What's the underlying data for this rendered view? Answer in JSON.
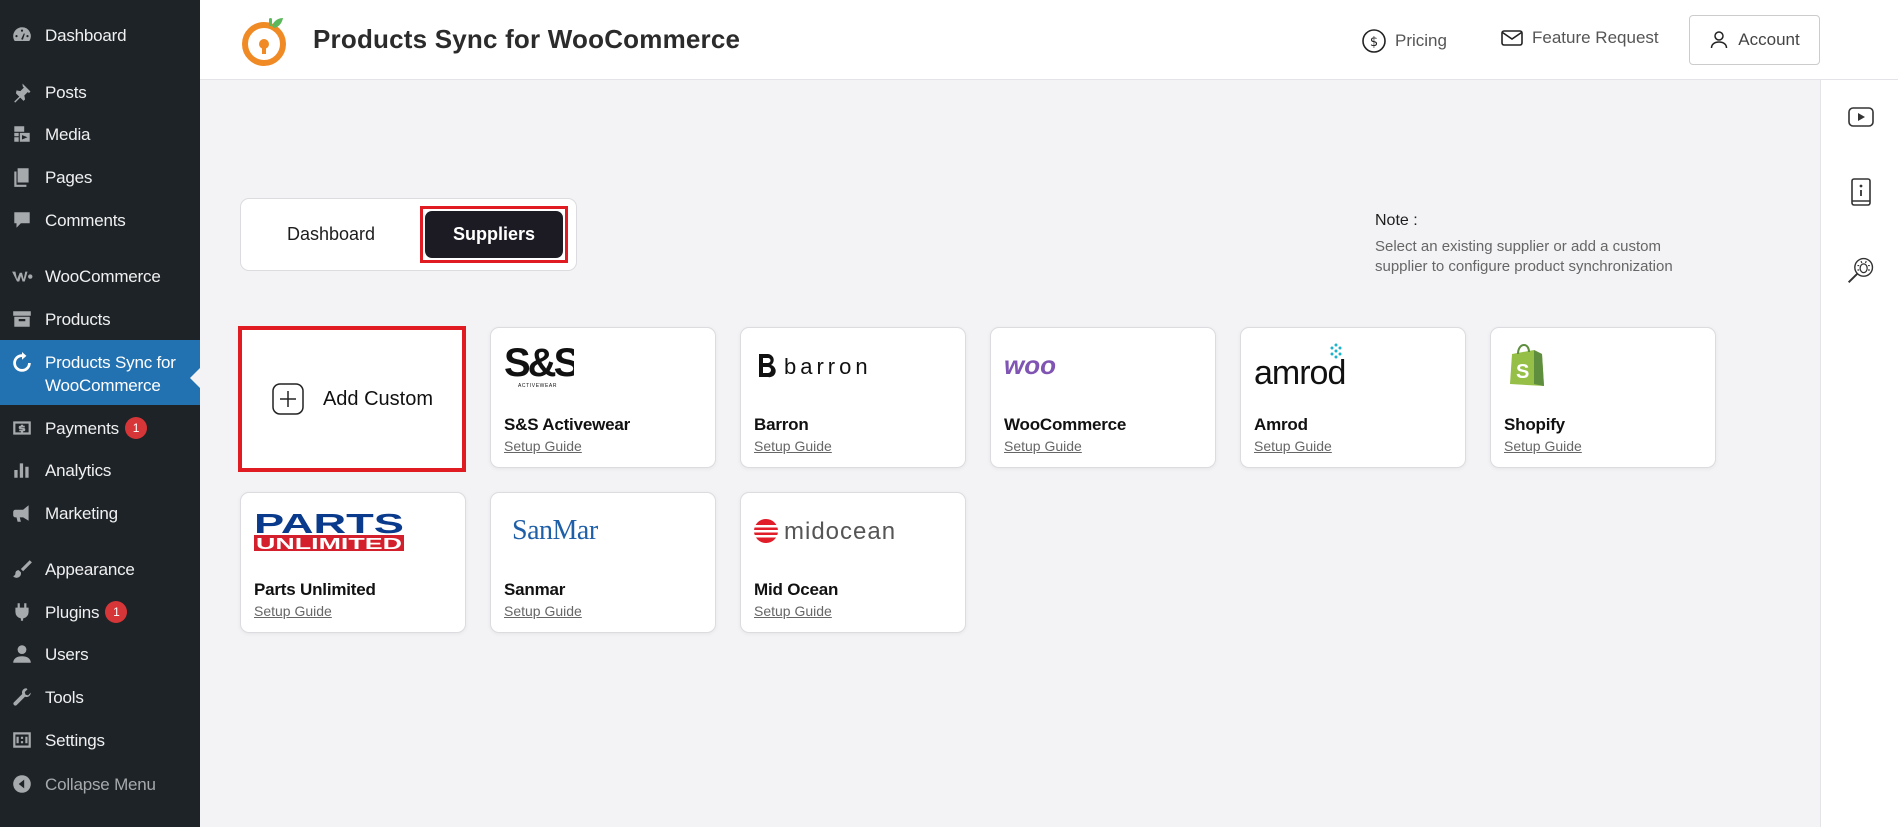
{
  "sidebar": {
    "items": [
      {
        "label": "Dashboard",
        "icon": "dashboard-icon"
      },
      {
        "label": "Posts",
        "icon": "pushpin-icon"
      },
      {
        "label": "Media",
        "icon": "media-icon"
      },
      {
        "label": "Pages",
        "icon": "pages-icon"
      },
      {
        "label": "Comments",
        "icon": "comment-icon"
      },
      {
        "label": "WooCommerce",
        "icon": "woocommerce-icon"
      },
      {
        "label": "Products",
        "icon": "archive-icon"
      },
      {
        "label": "Products Sync for WooCommerce",
        "icon": "sync-icon"
      },
      {
        "label": "Payments",
        "icon": "payments-icon",
        "badge": "1"
      },
      {
        "label": "Analytics",
        "icon": "analytics-icon"
      },
      {
        "label": "Marketing",
        "icon": "megaphone-icon"
      },
      {
        "label": "Appearance",
        "icon": "brush-icon"
      },
      {
        "label": "Plugins",
        "icon": "plugin-icon",
        "badge": "1"
      },
      {
        "label": "Users",
        "icon": "user-icon"
      },
      {
        "label": "Tools",
        "icon": "wrench-icon"
      },
      {
        "label": "Settings",
        "icon": "settings-icon"
      },
      {
        "label": "Collapse Menu",
        "icon": "collapse-icon"
      }
    ],
    "active_line1": "Products Sync for",
    "active_line2": "WooCommerce"
  },
  "header": {
    "title": "Products Sync for WooCommerce",
    "pricing": "Pricing",
    "feature_request": "Feature Request",
    "account": "Account"
  },
  "tabs": {
    "dashboard": "Dashboard",
    "suppliers": "Suppliers"
  },
  "note": {
    "title": "Note :",
    "text_line1": "Select an existing supplier or add a custom",
    "text_line2": "supplier to configure product synchronization"
  },
  "add_custom": "Add Custom",
  "suppliers": [
    {
      "name": "S&S Activewear",
      "guide": "Setup Guide",
      "logo_text": "S&S",
      "logo_sub": "ACTIVEWEAR"
    },
    {
      "name": "Barron",
      "guide": "Setup Guide",
      "logo_text": "barron"
    },
    {
      "name": "WooCommerce",
      "guide": "Setup Guide",
      "logo_text": "woo"
    },
    {
      "name": "Amrod",
      "guide": "Setup Guide",
      "logo_text": "amrod"
    },
    {
      "name": "Shopify",
      "guide": "Setup Guide"
    },
    {
      "name": "Parts Unlimited",
      "guide": "Setup Guide",
      "logo_text": "PARTS",
      "logo_sub": "UNLIMITED"
    },
    {
      "name": "Sanmar",
      "guide": "Setup Guide",
      "logo_text": "SanMar"
    },
    {
      "name": "Mid Ocean",
      "guide": "Setup Guide",
      "logo_text": "midocean"
    }
  ],
  "colors": {
    "sidebar_bg": "#1d2327",
    "active_menu": "#2271b1",
    "highlight_border": "#e01b22",
    "tab_active_bg": "#1c1b24",
    "woo_purple": "#7f54b3",
    "shopify_green": "#95bf47",
    "parts_blue": "#0a3a8c",
    "parts_red": "#d4202c",
    "sanmar_blue": "#1f5fa8",
    "midocean_red": "#e11d2a"
  }
}
